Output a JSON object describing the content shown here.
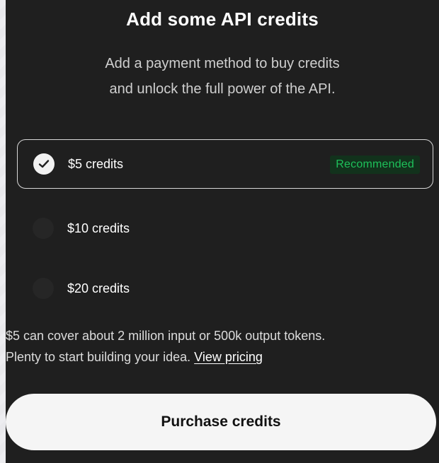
{
  "dialog": {
    "title": "Add some API credits",
    "subtitle_line1": "Add a payment method to buy credits",
    "subtitle_line2": "and unlock the full power of the API."
  },
  "options": [
    {
      "label": "$5 credits",
      "selected": true,
      "badge": "Recommended"
    },
    {
      "label": "$10 credits",
      "selected": false
    },
    {
      "label": "$20 credits",
      "selected": false
    }
  ],
  "info": {
    "line1": "$5 can cover about 2 million input or 500k output tokens.",
    "line2_prefix": "Plenty to start building your idea. ",
    "link_label": "View pricing"
  },
  "purchase_button_label": "Purchase credits",
  "colors": {
    "panel_bg": "#1f1f1f",
    "badge_text": "#1ec15a",
    "badge_bg": "#12321c",
    "button_bg": "#f5f5f5"
  }
}
